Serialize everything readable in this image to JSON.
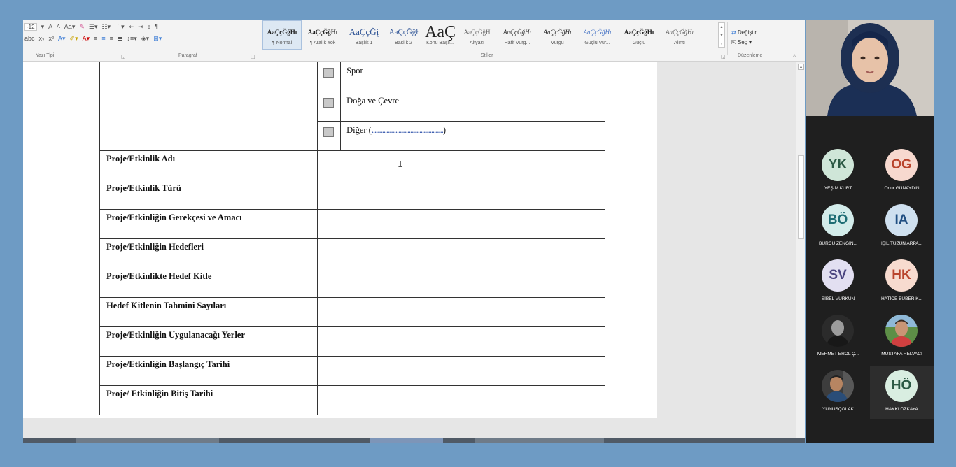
{
  "ribbon": {
    "font": {
      "size": "12",
      "grow_icon": "A",
      "shrink_icon": "A",
      "case_label": "Aa",
      "label": "Yazı Tipi"
    },
    "paragraph": {
      "label": "Paragraf"
    },
    "styles": {
      "label": "Stiller",
      "items": [
        {
          "sample": "AaÇçĞğHı",
          "name": "¶ Normal",
          "selected": true
        },
        {
          "sample": "AaÇçĞğHı",
          "name": "¶ Aralık Yok"
        },
        {
          "sample": "AaÇçĞį",
          "name": "Başlık 1"
        },
        {
          "sample": "AaÇçĞğł",
          "name": "Başlık 2"
        },
        {
          "sample": "AaÇ",
          "name": "Konu Başlı..."
        },
        {
          "sample": "AaÇçĞğH",
          "name": "Altyazı"
        },
        {
          "sample": "AaÇçĞğHı",
          "name": "Hafif Vurg..."
        },
        {
          "sample": "AaÇçĞğHı",
          "name": "Vurgu"
        },
        {
          "sample": "AaÇçĞğHı",
          "name": "Güçlü Vur..."
        },
        {
          "sample": "AaÇçĞğHı",
          "name": "Güçlü"
        },
        {
          "sample": "AaÇçĞğHı",
          "name": "Alıntı"
        }
      ]
    },
    "editing": {
      "label": "Düzenleme",
      "replace": "Değiştir",
      "select": "Seç"
    }
  },
  "form": {
    "options": [
      {
        "label": "Spor"
      },
      {
        "label": "Doğa ve Çevre"
      },
      {
        "label": "Diğer (",
        "dots": "................................................",
        "close": ")"
      }
    ],
    "rows": [
      {
        "label": "Proje/Etkinlik Adı",
        "value": ""
      },
      {
        "label": "Proje/Etkinlik Türü",
        "value": ""
      },
      {
        "label": "Proje/Etkinliğin Gerekçesi ve Amacı",
        "value": ""
      },
      {
        "label": "Proje/Etkinliğin Hedefleri",
        "value": ""
      },
      {
        "label": "Proje/Etkinlikte Hedef Kitle",
        "value": ""
      },
      {
        "label": "Hedef Kitlenin Tahmini Sayıları",
        "value": ""
      },
      {
        "label": "Proje/Etkinliğin Uygulanacağı Yerler",
        "value": ""
      },
      {
        "label": "Proje/Etkinliğin Başlangıç Tarihi",
        "value": ""
      },
      {
        "label": "Proje/ Etkinliğin Bitiş Tarihi",
        "value": ""
      }
    ]
  },
  "participants": [
    {
      "initials": "YK",
      "name": "YEŞİM KURT",
      "bg": "#cfe6d8",
      "fg": "#2c5a45"
    },
    {
      "initials": "OG",
      "name": "Onur GÜNAYDIN",
      "bg": "#f7d9cf",
      "fg": "#b9442c"
    },
    {
      "initials": "BÖ",
      "name": "BURCU ZENGİN...",
      "bg": "#d3ecea",
      "fg": "#1d6d74"
    },
    {
      "initials": "IA",
      "name": "IŞIL TÜZÜN ARPA...",
      "bg": "#cfe0ef",
      "fg": "#214f82"
    },
    {
      "initials": "SV",
      "name": "SİBEL VURKUN",
      "bg": "#e2dff1",
      "fg": "#4b4580"
    },
    {
      "initials": "HK",
      "name": "HATİCE BÜBER K...",
      "bg": "#f7dbcf",
      "fg": "#b9442c"
    },
    {
      "initials": "",
      "name": "MEHMET EROL Ç...",
      "photo": "man-bw"
    },
    {
      "initials": "",
      "name": "MUSTAFA HELVACI",
      "photo": "man-outdoor"
    },
    {
      "initials": "",
      "name": "YUNUSÇOLAK",
      "photo": "man-dark"
    },
    {
      "initials": "HÖ",
      "name": "HAKKI ÖZKAYA",
      "bg": "#d9eee1",
      "fg": "#2c5a45"
    }
  ]
}
